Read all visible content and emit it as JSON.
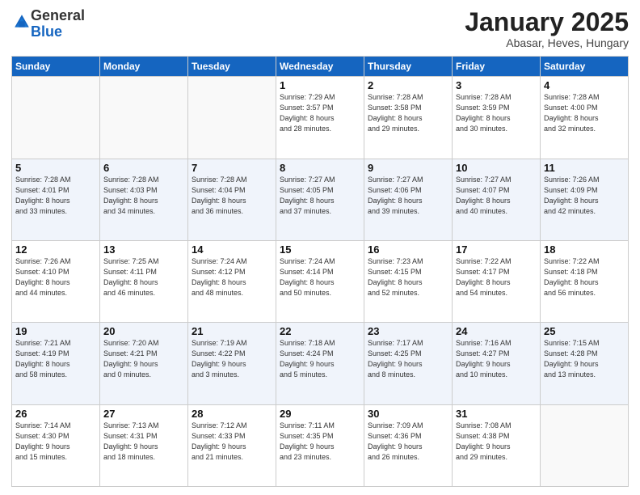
{
  "logo": {
    "general": "General",
    "blue": "Blue"
  },
  "header": {
    "month": "January 2025",
    "location": "Abasar, Heves, Hungary"
  },
  "weekdays": [
    "Sunday",
    "Monday",
    "Tuesday",
    "Wednesday",
    "Thursday",
    "Friday",
    "Saturday"
  ],
  "weeks": [
    [
      {
        "day": "",
        "info": ""
      },
      {
        "day": "",
        "info": ""
      },
      {
        "day": "",
        "info": ""
      },
      {
        "day": "1",
        "info": "Sunrise: 7:29 AM\nSunset: 3:57 PM\nDaylight: 8 hours\nand 28 minutes."
      },
      {
        "day": "2",
        "info": "Sunrise: 7:28 AM\nSunset: 3:58 PM\nDaylight: 8 hours\nand 29 minutes."
      },
      {
        "day": "3",
        "info": "Sunrise: 7:28 AM\nSunset: 3:59 PM\nDaylight: 8 hours\nand 30 minutes."
      },
      {
        "day": "4",
        "info": "Sunrise: 7:28 AM\nSunset: 4:00 PM\nDaylight: 8 hours\nand 32 minutes."
      }
    ],
    [
      {
        "day": "5",
        "info": "Sunrise: 7:28 AM\nSunset: 4:01 PM\nDaylight: 8 hours\nand 33 minutes."
      },
      {
        "day": "6",
        "info": "Sunrise: 7:28 AM\nSunset: 4:03 PM\nDaylight: 8 hours\nand 34 minutes."
      },
      {
        "day": "7",
        "info": "Sunrise: 7:28 AM\nSunset: 4:04 PM\nDaylight: 8 hours\nand 36 minutes."
      },
      {
        "day": "8",
        "info": "Sunrise: 7:27 AM\nSunset: 4:05 PM\nDaylight: 8 hours\nand 37 minutes."
      },
      {
        "day": "9",
        "info": "Sunrise: 7:27 AM\nSunset: 4:06 PM\nDaylight: 8 hours\nand 39 minutes."
      },
      {
        "day": "10",
        "info": "Sunrise: 7:27 AM\nSunset: 4:07 PM\nDaylight: 8 hours\nand 40 minutes."
      },
      {
        "day": "11",
        "info": "Sunrise: 7:26 AM\nSunset: 4:09 PM\nDaylight: 8 hours\nand 42 minutes."
      }
    ],
    [
      {
        "day": "12",
        "info": "Sunrise: 7:26 AM\nSunset: 4:10 PM\nDaylight: 8 hours\nand 44 minutes."
      },
      {
        "day": "13",
        "info": "Sunrise: 7:25 AM\nSunset: 4:11 PM\nDaylight: 8 hours\nand 46 minutes."
      },
      {
        "day": "14",
        "info": "Sunrise: 7:24 AM\nSunset: 4:12 PM\nDaylight: 8 hours\nand 48 minutes."
      },
      {
        "day": "15",
        "info": "Sunrise: 7:24 AM\nSunset: 4:14 PM\nDaylight: 8 hours\nand 50 minutes."
      },
      {
        "day": "16",
        "info": "Sunrise: 7:23 AM\nSunset: 4:15 PM\nDaylight: 8 hours\nand 52 minutes."
      },
      {
        "day": "17",
        "info": "Sunrise: 7:22 AM\nSunset: 4:17 PM\nDaylight: 8 hours\nand 54 minutes."
      },
      {
        "day": "18",
        "info": "Sunrise: 7:22 AM\nSunset: 4:18 PM\nDaylight: 8 hours\nand 56 minutes."
      }
    ],
    [
      {
        "day": "19",
        "info": "Sunrise: 7:21 AM\nSunset: 4:19 PM\nDaylight: 8 hours\nand 58 minutes."
      },
      {
        "day": "20",
        "info": "Sunrise: 7:20 AM\nSunset: 4:21 PM\nDaylight: 9 hours\nand 0 minutes."
      },
      {
        "day": "21",
        "info": "Sunrise: 7:19 AM\nSunset: 4:22 PM\nDaylight: 9 hours\nand 3 minutes."
      },
      {
        "day": "22",
        "info": "Sunrise: 7:18 AM\nSunset: 4:24 PM\nDaylight: 9 hours\nand 5 minutes."
      },
      {
        "day": "23",
        "info": "Sunrise: 7:17 AM\nSunset: 4:25 PM\nDaylight: 9 hours\nand 8 minutes."
      },
      {
        "day": "24",
        "info": "Sunrise: 7:16 AM\nSunset: 4:27 PM\nDaylight: 9 hours\nand 10 minutes."
      },
      {
        "day": "25",
        "info": "Sunrise: 7:15 AM\nSunset: 4:28 PM\nDaylight: 9 hours\nand 13 minutes."
      }
    ],
    [
      {
        "day": "26",
        "info": "Sunrise: 7:14 AM\nSunset: 4:30 PM\nDaylight: 9 hours\nand 15 minutes."
      },
      {
        "day": "27",
        "info": "Sunrise: 7:13 AM\nSunset: 4:31 PM\nDaylight: 9 hours\nand 18 minutes."
      },
      {
        "day": "28",
        "info": "Sunrise: 7:12 AM\nSunset: 4:33 PM\nDaylight: 9 hours\nand 21 minutes."
      },
      {
        "day": "29",
        "info": "Sunrise: 7:11 AM\nSunset: 4:35 PM\nDaylight: 9 hours\nand 23 minutes."
      },
      {
        "day": "30",
        "info": "Sunrise: 7:09 AM\nSunset: 4:36 PM\nDaylight: 9 hours\nand 26 minutes."
      },
      {
        "day": "31",
        "info": "Sunrise: 7:08 AM\nSunset: 4:38 PM\nDaylight: 9 hours\nand 29 minutes."
      },
      {
        "day": "",
        "info": ""
      }
    ]
  ]
}
